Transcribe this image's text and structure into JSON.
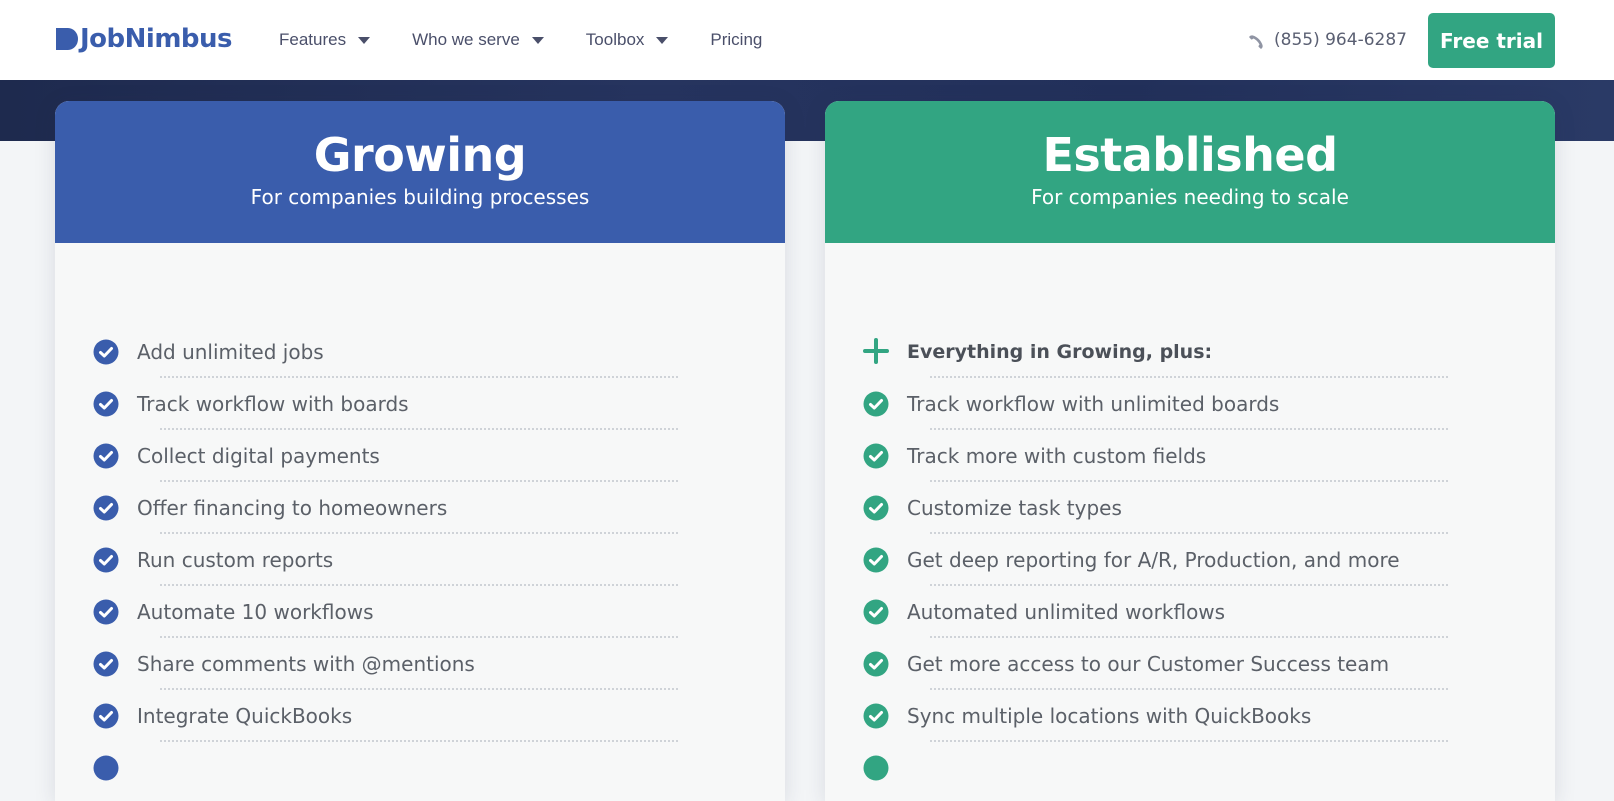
{
  "nav": {
    "logo_text": "JobNimbus",
    "items": [
      {
        "label": "Features",
        "dropdown": true
      },
      {
        "label": "Who we serve",
        "dropdown": true
      },
      {
        "label": "Toolbox",
        "dropdown": true
      },
      {
        "label": "Pricing",
        "dropdown": false
      }
    ],
    "phone": "(855) 964-6287",
    "cta_label": "Free trial"
  },
  "colors": {
    "brand_blue": "#3a5dac",
    "brand_green": "#32a582",
    "hero_band": "#22305a"
  },
  "plans": {
    "growing": {
      "title": "Growing",
      "subtitle": "For companies building processes",
      "icon": "check-circle-icon",
      "features": [
        "Add unlimited jobs",
        "Track workflow with boards",
        "Collect digital payments",
        "Offer financing to homeowners",
        "Run custom reports",
        "Automate 10 workflows",
        "Share comments with @mentions",
        "Integrate QuickBooks"
      ]
    },
    "established": {
      "title": "Established",
      "subtitle": "For companies needing to scale",
      "icon": "check-circle-icon",
      "intro": "Everything in Growing, plus:",
      "features": [
        "Track workflow with unlimited boards",
        "Track more with custom fields",
        "Customize task types",
        "Get deep reporting for A/R, Production, and more",
        "Automated unlimited workflows",
        "Get more access to our Customer Success team",
        "Sync multiple locations with QuickBooks"
      ]
    }
  }
}
